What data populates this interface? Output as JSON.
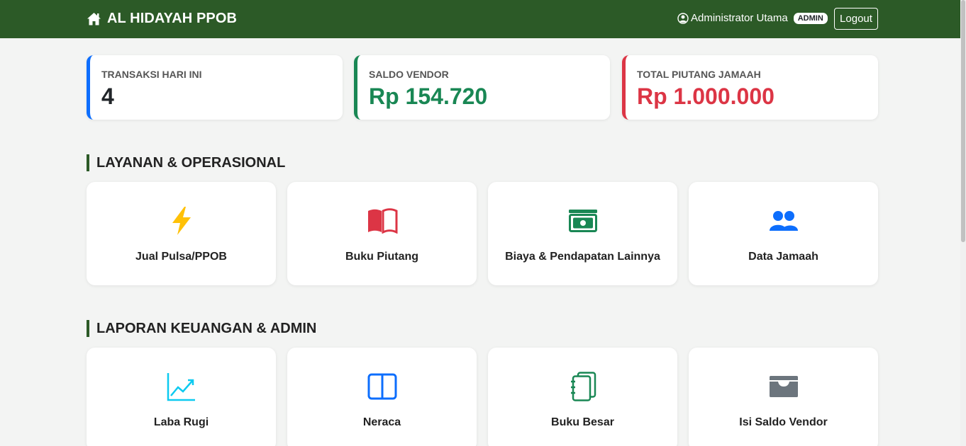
{
  "header": {
    "brand": "AL HIDAYAH PPOB",
    "user_name": "Administrator Utama",
    "role_badge": "ADMIN",
    "logout_label": "Logout",
    "bg_color": "#2c5a27"
  },
  "stats": [
    {
      "label": "TRANSAKSI HARI INI",
      "value": "4",
      "color": "#212529",
      "accent": "#0d6efd"
    },
    {
      "label": "SALDO VENDOR",
      "value": "Rp 154.720",
      "color": "#198754",
      "accent": "#198754"
    },
    {
      "label": "TOTAL PIUTANG JAMAAH",
      "value": "Rp 1.000.000",
      "color": "#dc3545",
      "accent": "#dc3545"
    }
  ],
  "sections": {
    "layanan": {
      "title": "LAYANAN & OPERASIONAL",
      "items": [
        {
          "label": "Jual Pulsa/PPOB",
          "icon": "lightning-icon"
        },
        {
          "label": "Buku Piutang",
          "icon": "book-icon"
        },
        {
          "label": "Biaya & Pendapatan Lainnya",
          "icon": "cash-icon"
        },
        {
          "label": "Data Jamaah",
          "icon": "people-icon"
        }
      ]
    },
    "laporan": {
      "title": "LAPORAN KEUANGAN & ADMIN",
      "items": [
        {
          "label": "Laba Rugi",
          "icon": "graph-up-icon"
        },
        {
          "label": "Neraca",
          "icon": "layout-split-icon"
        },
        {
          "label": "Buku Besar",
          "icon": "journals-icon"
        },
        {
          "label": "Isi Saldo Vendor",
          "icon": "wallet-icon"
        }
      ]
    }
  }
}
